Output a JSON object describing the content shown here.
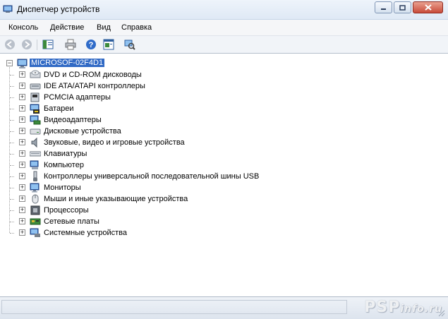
{
  "window": {
    "title": "Диспетчер устройств",
    "buttons": [
      "minimize",
      "maximize",
      "close"
    ]
  },
  "menu": {
    "items": [
      "Консоль",
      "Действие",
      "Вид",
      "Справка"
    ]
  },
  "toolbar": {
    "icons": [
      "back-icon",
      "forward-icon",
      "console-tree-icon",
      "print-icon",
      "help-icon",
      "properties-icon",
      "scan-hardware-icon"
    ]
  },
  "tree": {
    "root": "MICROSOF-02F4D1",
    "items": [
      {
        "label": "DVD и CD-ROM дисководы",
        "icon": "cdrom-icon"
      },
      {
        "label": "IDE ATA/ATAPI контроллеры",
        "icon": "ide-controller-icon"
      },
      {
        "label": "PCMCIA адаптеры",
        "icon": "pcmcia-icon"
      },
      {
        "label": "Батареи",
        "icon": "battery-icon"
      },
      {
        "label": "Видеоадаптеры",
        "icon": "display-adapter-icon"
      },
      {
        "label": "Дисковые устройства",
        "icon": "disk-drive-icon"
      },
      {
        "label": "Звуковые, видео и игровые устройства",
        "icon": "sound-icon"
      },
      {
        "label": "Клавиатуры",
        "icon": "keyboard-icon"
      },
      {
        "label": "Компьютер",
        "icon": "computer-icon"
      },
      {
        "label": "Контроллеры универсальной последовательной шины USB",
        "icon": "usb-icon"
      },
      {
        "label": "Мониторы",
        "icon": "monitor-icon"
      },
      {
        "label": "Мыши и иные указывающие устройства",
        "icon": "mouse-icon"
      },
      {
        "label": "Процессоры",
        "icon": "processor-icon"
      },
      {
        "label": "Сетевые платы",
        "icon": "network-card-icon"
      },
      {
        "label": "Системные устройства",
        "icon": "system-devices-icon"
      }
    ]
  },
  "watermark": {
    "main": "PSP",
    "suffix": "info.ru"
  },
  "colors": {
    "selection": "#316ac5",
    "titlebar": "#dfe9f5",
    "close_button": "#c94c3a"
  }
}
